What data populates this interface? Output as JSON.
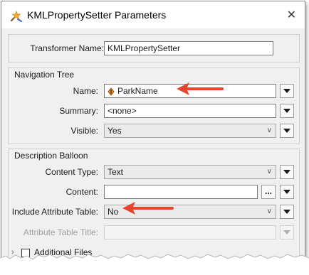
{
  "window": {
    "title": "KMLPropertySetter Parameters",
    "close_glyph": "✕",
    "icon": "transformer-icon"
  },
  "transformer": {
    "label": "Transformer Name:",
    "value": "KMLPropertySetter"
  },
  "navigation_tree": {
    "legend": "Navigation Tree",
    "name_label": "Name:",
    "name_value": "ParkName",
    "name_value_icon": "attribute-icon",
    "summary_label": "Summary:",
    "summary_value": "<none>",
    "visible_label": "Visible:",
    "visible_value": "Yes"
  },
  "description_balloon": {
    "legend": "Description Balloon",
    "content_type_label": "Content Type:",
    "content_type_value": "Text",
    "content_label": "Content:",
    "content_value": "",
    "ellipsis_label": "...",
    "include_attr_label": "Include Attribute Table:",
    "include_attr_value": "No",
    "attr_title_label": "Attribute Table Title:",
    "attr_title_value": ""
  },
  "additional_files": {
    "label": "Additional Files",
    "checked": false
  },
  "colors": {
    "annotation_arrow": "#e8432c",
    "field_border": "#7a7a7a",
    "combo_bg": "#ebebeb",
    "dialog_bg": "#f0f0f0"
  }
}
